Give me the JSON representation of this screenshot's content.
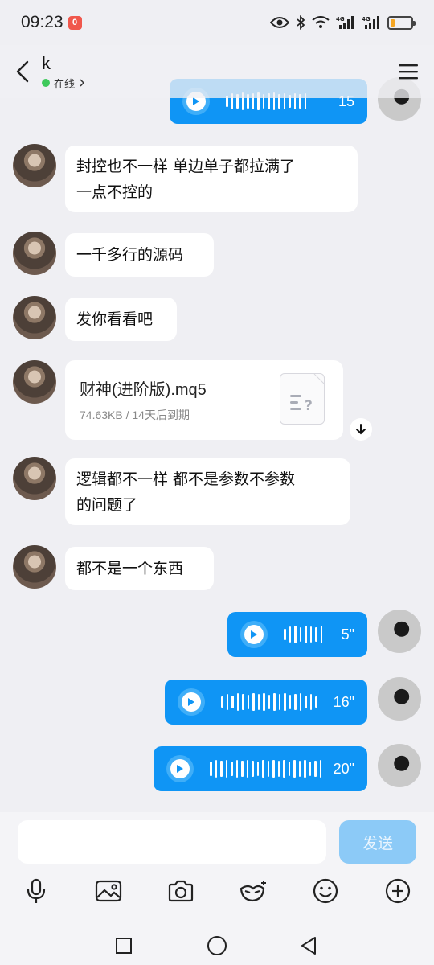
{
  "status_bar": {
    "time": "09:23",
    "notification_badge": "0",
    "network_1": "4G",
    "network_2": "4G",
    "battery_level": 0.2
  },
  "header": {
    "contact_name": "k",
    "presence": "在线"
  },
  "messages": {
    "top_voice_duration": "15",
    "text_1": "封控也不一样 单边单子都拉满了",
    "text_1b": "一点不控的",
    "text_2": "一千多行的源码",
    "text_3": "发你看看吧",
    "file": {
      "name": "财神(进阶版).mq5",
      "meta": "74.63KB / 14天后到期"
    },
    "text_4": "逻辑都不一样 都不是参数不参数",
    "text_4b": "的问题了",
    "text_5": "都不是一个东西",
    "voice_1_duration": "5\"",
    "voice_2_duration": "16\"",
    "voice_3_duration": "20\""
  },
  "input": {
    "placeholder": "",
    "send_label": "发送"
  },
  "colors": {
    "accent": "#0f95f5",
    "send_disabled": "#8ccaf7",
    "online": "#3ec95b"
  }
}
